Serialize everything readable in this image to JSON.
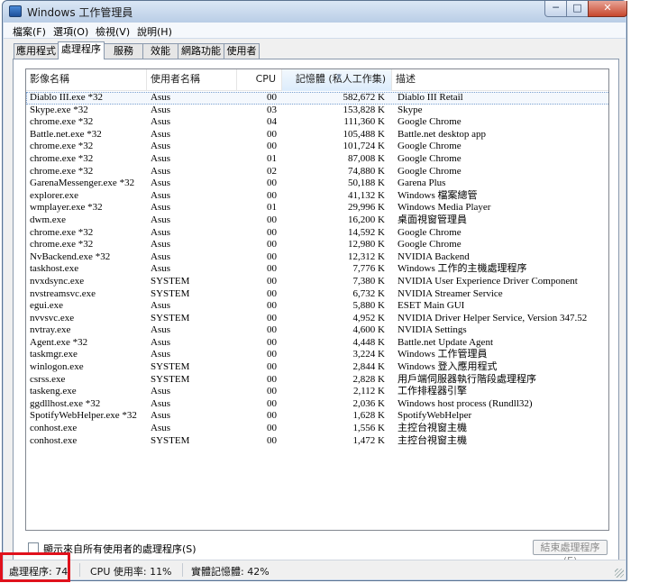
{
  "window": {
    "title": "Windows 工作管理員",
    "controls": {
      "minimize": "─",
      "maximize": "□",
      "close": "✕"
    }
  },
  "menu": [
    {
      "label": "檔案(F)"
    },
    {
      "label": "選項(O)"
    },
    {
      "label": "檢視(V)"
    },
    {
      "label": "說明(H)"
    }
  ],
  "tabs": [
    {
      "label": "應用程式"
    },
    {
      "label": "處理程序"
    },
    {
      "label": "服務"
    },
    {
      "label": "效能"
    },
    {
      "label": "網路功能"
    },
    {
      "label": "使用者"
    }
  ],
  "columns": {
    "name": "影像名稱",
    "user": "使用者名稱",
    "cpu": "CPU",
    "mem": "記憶體 (私人工作集)",
    "desc": "描述"
  },
  "processes": [
    {
      "name": "Diablo III.exe *32",
      "user": "Asus",
      "cpu": "00",
      "mem": "582,672 K",
      "desc": "Diablo III Retail"
    },
    {
      "name": "Skype.exe *32",
      "user": "Asus",
      "cpu": "03",
      "mem": "153,828 K",
      "desc": "Skype"
    },
    {
      "name": "chrome.exe *32",
      "user": "Asus",
      "cpu": "04",
      "mem": "111,360 K",
      "desc": "Google Chrome"
    },
    {
      "name": "Battle.net.exe *32",
      "user": "Asus",
      "cpu": "00",
      "mem": "105,488 K",
      "desc": "Battle.net desktop app"
    },
    {
      "name": "chrome.exe *32",
      "user": "Asus",
      "cpu": "00",
      "mem": "101,724 K",
      "desc": "Google Chrome"
    },
    {
      "name": "chrome.exe *32",
      "user": "Asus",
      "cpu": "01",
      "mem": "87,008 K",
      "desc": "Google Chrome"
    },
    {
      "name": "chrome.exe *32",
      "user": "Asus",
      "cpu": "02",
      "mem": "74,880 K",
      "desc": "Google Chrome"
    },
    {
      "name": "GarenaMessenger.exe *32",
      "user": "Asus",
      "cpu": "00",
      "mem": "50,188 K",
      "desc": "Garena Plus"
    },
    {
      "name": "explorer.exe",
      "user": "Asus",
      "cpu": "00",
      "mem": "41,132 K",
      "desc": "Windows 檔案總管"
    },
    {
      "name": "wmplayer.exe *32",
      "user": "Asus",
      "cpu": "01",
      "mem": "29,996 K",
      "desc": "Windows Media Player"
    },
    {
      "name": "dwm.exe",
      "user": "Asus",
      "cpu": "00",
      "mem": "16,200 K",
      "desc": "桌面視窗管理員"
    },
    {
      "name": "chrome.exe *32",
      "user": "Asus",
      "cpu": "00",
      "mem": "14,592 K",
      "desc": "Google Chrome"
    },
    {
      "name": "chrome.exe *32",
      "user": "Asus",
      "cpu": "00",
      "mem": "12,980 K",
      "desc": "Google Chrome"
    },
    {
      "name": "NvBackend.exe *32",
      "user": "Asus",
      "cpu": "00",
      "mem": "12,312 K",
      "desc": "NVIDIA Backend"
    },
    {
      "name": "taskhost.exe",
      "user": "Asus",
      "cpu": "00",
      "mem": "7,776 K",
      "desc": "Windows 工作的主機處理程序"
    },
    {
      "name": "nvxdsync.exe",
      "user": "SYSTEM",
      "cpu": "00",
      "mem": "7,380 K",
      "desc": "NVIDIA User Experience Driver Component"
    },
    {
      "name": "nvstreamsvc.exe",
      "user": "SYSTEM",
      "cpu": "00",
      "mem": "6,732 K",
      "desc": "NVIDIA Streamer Service"
    },
    {
      "name": "egui.exe",
      "user": "Asus",
      "cpu": "00",
      "mem": "5,880 K",
      "desc": "ESET Main GUI"
    },
    {
      "name": "nvvsvc.exe",
      "user": "SYSTEM",
      "cpu": "00",
      "mem": "4,952 K",
      "desc": "NVIDIA Driver Helper Service, Version 347.52"
    },
    {
      "name": "nvtray.exe",
      "user": "Asus",
      "cpu": "00",
      "mem": "4,600 K",
      "desc": "NVIDIA Settings"
    },
    {
      "name": "Agent.exe *32",
      "user": "Asus",
      "cpu": "00",
      "mem": "4,448 K",
      "desc": "Battle.net Update Agent"
    },
    {
      "name": "taskmgr.exe",
      "user": "Asus",
      "cpu": "00",
      "mem": "3,224 K",
      "desc": "Windows 工作管理員"
    },
    {
      "name": "winlogon.exe",
      "user": "SYSTEM",
      "cpu": "00",
      "mem": "2,844 K",
      "desc": "Windows 登入應用程式"
    },
    {
      "name": "csrss.exe",
      "user": "SYSTEM",
      "cpu": "00",
      "mem": "2,828 K",
      "desc": "用戶端伺服器執行階段處理程序"
    },
    {
      "name": "taskeng.exe",
      "user": "Asus",
      "cpu": "00",
      "mem": "2,112 K",
      "desc": "工作排程器引擎"
    },
    {
      "name": "ggdllhost.exe *32",
      "user": "Asus",
      "cpu": "00",
      "mem": "2,036 K",
      "desc": "Windows host process (Rundll32)"
    },
    {
      "name": "SpotifyWebHelper.exe *32",
      "user": "Asus",
      "cpu": "00",
      "mem": "1,628 K",
      "desc": "SpotifyWebHelper"
    },
    {
      "name": "conhost.exe",
      "user": "Asus",
      "cpu": "00",
      "mem": "1,556 K",
      "desc": "主控台視窗主機"
    },
    {
      "name": "conhost.exe",
      "user": "SYSTEM",
      "cpu": "00",
      "mem": "1,472 K",
      "desc": "主控台視窗主機"
    }
  ],
  "show_all_label": "顯示來自所有使用者的處理程序(S)",
  "end_process_label": "結束處理程序(E)",
  "status": {
    "processes": "處理程序: 74",
    "cpu": "CPU 使用率: 11%",
    "memory": "實體記憶體: 42%"
  },
  "colors": {
    "highlight": "#e0111c",
    "frame": "#c6d6ea"
  }
}
